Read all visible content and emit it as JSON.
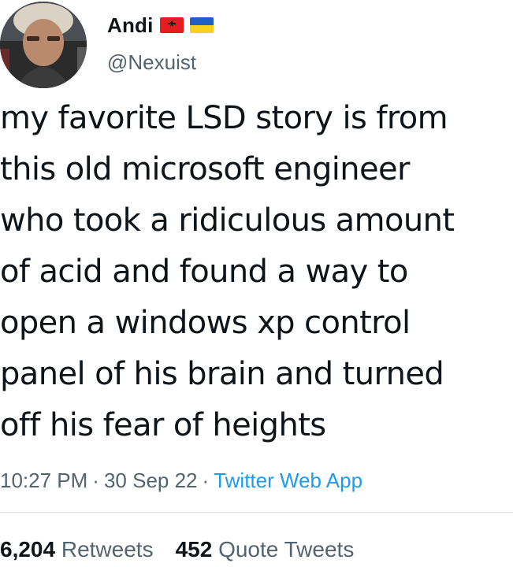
{
  "author": {
    "display_name": "Andi",
    "handle": "@Nexuist",
    "flags": [
      "albania-flag-icon",
      "ukraine-flag-icon"
    ]
  },
  "tweet": {
    "text": "my favorite LSD story is from\nthis old microsoft engineer\nwho took a ridiculous amount\nof acid and found a way to\nopen a windows xp control\npanel of his brain and turned\noff his fear of heights"
  },
  "meta": {
    "time": "10:27 PM",
    "separator": "·",
    "date": "30 Sep 22",
    "source": "Twitter Web App"
  },
  "stats": {
    "retweets_count": "6,204",
    "retweets_label": "Retweets",
    "quotes_count": "452",
    "quotes_label": "Quote Tweets"
  },
  "colors": {
    "text": "#0f1419",
    "secondary": "#53646e",
    "link": "#1d9bf0",
    "divider": "#dfe5e9"
  }
}
